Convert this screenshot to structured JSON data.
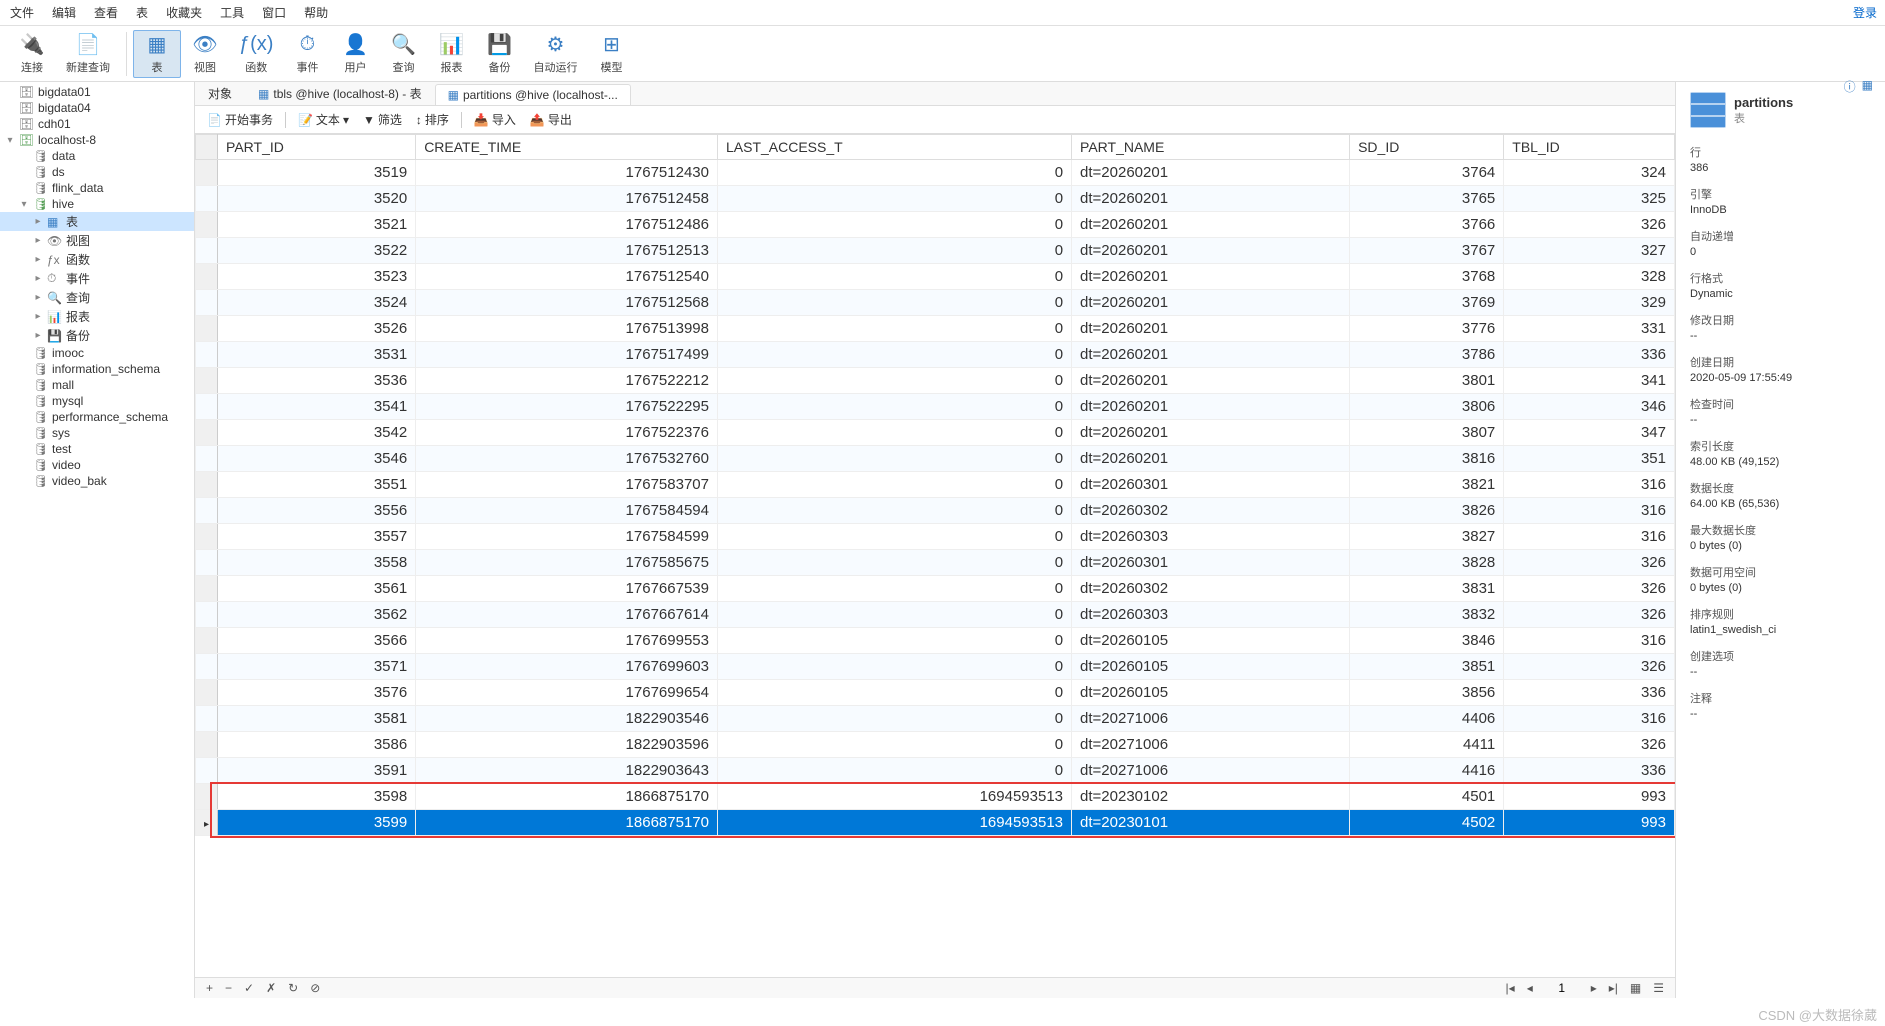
{
  "menu": [
    "文件",
    "编辑",
    "查看",
    "表",
    "收藏夹",
    "工具",
    "窗口",
    "帮助"
  ],
  "login": "登录",
  "toolbar": [
    {
      "label": "连接",
      "icon": "🔌"
    },
    {
      "label": "新建查询",
      "icon": "📄"
    },
    {
      "label": "表",
      "icon": "▦",
      "active": true
    },
    {
      "label": "视图",
      "icon": "👁"
    },
    {
      "label": "f(x)",
      "icon": "ƒ(x)",
      "sub": "函数"
    },
    {
      "label": "事件",
      "icon": "⏱"
    },
    {
      "label": "用户",
      "icon": "👤"
    },
    {
      "label": "查询",
      "icon": "🔍"
    },
    {
      "label": "报表",
      "icon": "📊"
    },
    {
      "label": "备份",
      "icon": "💾"
    },
    {
      "label": "自动运行",
      "icon": "⚙"
    },
    {
      "label": "模型",
      "icon": "⊞"
    }
  ],
  "tree": [
    {
      "label": "bigdata01",
      "icon": "🗄",
      "cls": "dark-icon",
      "indent": 0
    },
    {
      "label": "bigdata04",
      "icon": "🗄",
      "cls": "dark-icon",
      "indent": 0
    },
    {
      "label": "cdh01",
      "icon": "🗄",
      "cls": "dark-icon",
      "indent": 0
    },
    {
      "label": "localhost-8",
      "icon": "🗄",
      "cls": "db-icon",
      "indent": 0,
      "toggle": "▾"
    },
    {
      "label": "data",
      "icon": "🛢",
      "cls": "dark-icon",
      "indent": 1
    },
    {
      "label": "ds",
      "icon": "🛢",
      "cls": "dark-icon",
      "indent": 1
    },
    {
      "label": "flink_data",
      "icon": "🛢",
      "cls": "dark-icon",
      "indent": 1
    },
    {
      "label": "hive",
      "icon": "🛢",
      "cls": "db-icon",
      "indent": 1,
      "toggle": "▾"
    },
    {
      "label": "表",
      "icon": "▦",
      "cls": "tbl-icon",
      "indent": 2,
      "toggle": "▸",
      "selected": true
    },
    {
      "label": "视图",
      "icon": "👁",
      "cls": "dark-icon",
      "indent": 2,
      "toggle": "▸"
    },
    {
      "label": "函数",
      "icon": "ƒx",
      "cls": "dark-icon",
      "indent": 2,
      "toggle": "▸"
    },
    {
      "label": "事件",
      "icon": "⏱",
      "cls": "dark-icon",
      "indent": 2,
      "toggle": "▸"
    },
    {
      "label": "查询",
      "icon": "🔍",
      "cls": "dark-icon",
      "indent": 2,
      "toggle": "▸"
    },
    {
      "label": "报表",
      "icon": "📊",
      "cls": "dark-icon",
      "indent": 2,
      "toggle": "▸"
    },
    {
      "label": "备份",
      "icon": "💾",
      "cls": "dark-icon",
      "indent": 2,
      "toggle": "▸"
    },
    {
      "label": "imooc",
      "icon": "🛢",
      "cls": "dark-icon",
      "indent": 1
    },
    {
      "label": "information_schema",
      "icon": "🛢",
      "cls": "dark-icon",
      "indent": 1
    },
    {
      "label": "mall",
      "icon": "🛢",
      "cls": "dark-icon",
      "indent": 1
    },
    {
      "label": "mysql",
      "icon": "🛢",
      "cls": "dark-icon",
      "indent": 1
    },
    {
      "label": "performance_schema",
      "icon": "🛢",
      "cls": "dark-icon",
      "indent": 1
    },
    {
      "label": "sys",
      "icon": "🛢",
      "cls": "dark-icon",
      "indent": 1
    },
    {
      "label": "test",
      "icon": "🛢",
      "cls": "dark-icon",
      "indent": 1
    },
    {
      "label": "video",
      "icon": "🛢",
      "cls": "dark-icon",
      "indent": 1
    },
    {
      "label": "video_bak",
      "icon": "🛢",
      "cls": "dark-icon",
      "indent": 1
    }
  ],
  "tabs": [
    {
      "label": "对象"
    },
    {
      "label": "tbls @hive (localhost-8) - 表",
      "icon": "▦"
    },
    {
      "label": "partitions @hive (localhost-...",
      "icon": "▦",
      "active": true
    }
  ],
  "subtoolbar": {
    "begin": "开始事务",
    "text": "文本",
    "filter": "筛选",
    "sort": "排序",
    "import": "导入",
    "export": "导出"
  },
  "columns": [
    "PART_ID",
    "CREATE_TIME",
    "LAST_ACCESS_T",
    "PART_NAME",
    "SD_ID",
    "TBL_ID"
  ],
  "rows": [
    [
      "3519",
      "1767512430",
      "0",
      "dt=20260201",
      "3764",
      "324"
    ],
    [
      "3520",
      "1767512458",
      "0",
      "dt=20260201",
      "3765",
      "325"
    ],
    [
      "3521",
      "1767512486",
      "0",
      "dt=20260201",
      "3766",
      "326"
    ],
    [
      "3522",
      "1767512513",
      "0",
      "dt=20260201",
      "3767",
      "327"
    ],
    [
      "3523",
      "1767512540",
      "0",
      "dt=20260201",
      "3768",
      "328"
    ],
    [
      "3524",
      "1767512568",
      "0",
      "dt=20260201",
      "3769",
      "329"
    ],
    [
      "3526",
      "1767513998",
      "0",
      "dt=20260201",
      "3776",
      "331"
    ],
    [
      "3531",
      "1767517499",
      "0",
      "dt=20260201",
      "3786",
      "336"
    ],
    [
      "3536",
      "1767522212",
      "0",
      "dt=20260201",
      "3801",
      "341"
    ],
    [
      "3541",
      "1767522295",
      "0",
      "dt=20260201",
      "3806",
      "346"
    ],
    [
      "3542",
      "1767522376",
      "0",
      "dt=20260201",
      "3807",
      "347"
    ],
    [
      "3546",
      "1767532760",
      "0",
      "dt=20260201",
      "3816",
      "351"
    ],
    [
      "3551",
      "1767583707",
      "0",
      "dt=20260301",
      "3821",
      "316"
    ],
    [
      "3556",
      "1767584594",
      "0",
      "dt=20260302",
      "3826",
      "316"
    ],
    [
      "3557",
      "1767584599",
      "0",
      "dt=20260303",
      "3827",
      "316"
    ],
    [
      "3558",
      "1767585675",
      "0",
      "dt=20260301",
      "3828",
      "326"
    ],
    [
      "3561",
      "1767667539",
      "0",
      "dt=20260302",
      "3831",
      "326"
    ],
    [
      "3562",
      "1767667614",
      "0",
      "dt=20260303",
      "3832",
      "326"
    ],
    [
      "3566",
      "1767699553",
      "0",
      "dt=20260105",
      "3846",
      "316"
    ],
    [
      "3571",
      "1767699603",
      "0",
      "dt=20260105",
      "3851",
      "326"
    ],
    [
      "3576",
      "1767699654",
      "0",
      "dt=20260105",
      "3856",
      "336"
    ],
    [
      "3581",
      "1822903546",
      "0",
      "dt=20271006",
      "4406",
      "316"
    ],
    [
      "3586",
      "1822903596",
      "0",
      "dt=20271006",
      "4411",
      "326"
    ],
    [
      "3591",
      "1822903643",
      "0",
      "dt=20271006",
      "4416",
      "336"
    ],
    [
      "3598",
      "1866875170",
      "1694593513",
      "dt=20230102",
      "4501",
      "993"
    ],
    [
      "3599",
      "1866875170",
      "1694593513",
      "dt=20230101",
      "4502",
      "993"
    ]
  ],
  "selected_row": 25,
  "bottombar": {
    "page": "1"
  },
  "info": {
    "title": "partitions",
    "subtitle": "表",
    "rows_label": "行",
    "rows": "386",
    "engine_label": "引擎",
    "engine": "InnoDB",
    "autoinc_label": "自动递增",
    "autoinc": "0",
    "rowfmt_label": "行格式",
    "rowfmt": "Dynamic",
    "modified_label": "修改日期",
    "modified": "--",
    "created_label": "创建日期",
    "created": "2020-05-09 17:55:49",
    "checked_label": "检查时间",
    "checked": "--",
    "idxlen_label": "索引长度",
    "idxlen": "48.00 KB (49,152)",
    "datalen_label": "数据长度",
    "datalen": "64.00 KB (65,536)",
    "maxdata_label": "最大数据长度",
    "maxdata": "0 bytes (0)",
    "datafree_label": "数据可用空间",
    "datafree": "0 bytes (0)",
    "collation_label": "排序规则",
    "collation": "latin1_swedish_ci",
    "createopt_label": "创建选项",
    "createopt": "--",
    "comment_label": "注释",
    "comment": "--"
  },
  "watermark": "CSDN @大数据徐葳"
}
